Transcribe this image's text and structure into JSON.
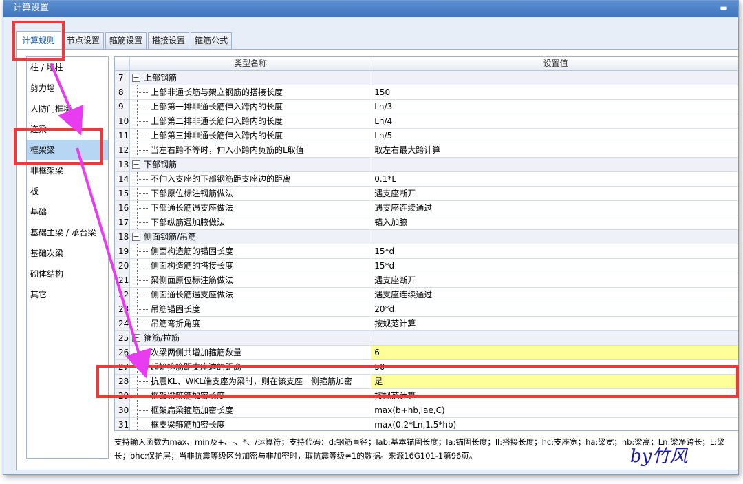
{
  "window": {
    "title": "计算设置",
    "close_glyph": "▬"
  },
  "tabs": [
    {
      "label": "计算规则",
      "active": true
    },
    {
      "label": "节点设置",
      "active": false
    },
    {
      "label": "箍筋设置",
      "active": false
    },
    {
      "label": "搭接设置",
      "active": false
    },
    {
      "label": "箍筋公式",
      "active": false
    }
  ],
  "sidebar": {
    "items": [
      {
        "label": "柱 / 墙柱"
      },
      {
        "label": "剪力墙"
      },
      {
        "label": "人防门框墙"
      },
      {
        "label": "连梁"
      },
      {
        "label": "框架梁",
        "selected": true
      },
      {
        "label": "非框架梁"
      },
      {
        "label": "板"
      },
      {
        "label": "基础"
      },
      {
        "label": "基础主梁 / 承台梁"
      },
      {
        "label": "基础次梁"
      },
      {
        "label": "砌体结构"
      },
      {
        "label": "其它"
      }
    ]
  },
  "grid": {
    "headers": {
      "name": "类型名称",
      "value": "设置值"
    },
    "rows": [
      {
        "num": "7",
        "name": "上部钢筋",
        "value": "",
        "group": true
      },
      {
        "num": "8",
        "name": "上部非通长筋与架立钢筋的搭接长度",
        "value": "150"
      },
      {
        "num": "9",
        "name": "上部第一排非通长筋伸入跨内的长度",
        "value": "Ln/3"
      },
      {
        "num": "10",
        "name": "上部第二排非通长筋伸入跨内的长度",
        "value": "Ln/4"
      },
      {
        "num": "11",
        "name": "上部第三排非通长筋伸入跨内的长度",
        "value": "Ln/5"
      },
      {
        "num": "12",
        "name": "当左右跨不等时，伸入小跨内负筋的L取值",
        "value": "取左右最大跨计算"
      },
      {
        "num": "13",
        "name": "下部钢筋",
        "value": "",
        "group": true
      },
      {
        "num": "14",
        "name": "不伸入支座的下部钢筋距支座边的距离",
        "value": "0.1*L"
      },
      {
        "num": "15",
        "name": "下部原位标注钢筋做法",
        "value": "遇支座断开"
      },
      {
        "num": "16",
        "name": "下部通长筋遇支座做法",
        "value": "遇支座连续通过"
      },
      {
        "num": "17",
        "name": "下部纵筋遇加腋做法",
        "value": "锚入加腋"
      },
      {
        "num": "18",
        "name": "侧面钢筋/吊筋",
        "value": "",
        "group": true
      },
      {
        "num": "19",
        "name": "侧面构造筋的锚固长度",
        "value": "15*d"
      },
      {
        "num": "20",
        "name": "侧面构造筋的搭接长度",
        "value": "15*d"
      },
      {
        "num": "21",
        "name": "梁侧面原位标注筋做法",
        "value": "遇支座断开"
      },
      {
        "num": "22",
        "name": "侧面通长筋遇支座做法",
        "value": "遇支座连续通过"
      },
      {
        "num": "23",
        "name": "吊筋锚固长度",
        "value": "20*d"
      },
      {
        "num": "24",
        "name": "吊筋弯折角度",
        "value": "按规范计算"
      },
      {
        "num": "25",
        "name": "箍筋/拉筋",
        "value": "",
        "group": true
      },
      {
        "num": "26",
        "name": "次梁两侧共增加箍筋数量",
        "value": "6",
        "highlight": true
      },
      {
        "num": "27",
        "name": "起始箍筋距支座边的距离",
        "value": "50"
      },
      {
        "num": "28",
        "name": "抗震KL、WKL端支座为梁时，则在该支座一侧箍筋加密",
        "value": "是",
        "highlight": true
      },
      {
        "num": "29",
        "name": "框架梁箍筋加密长度",
        "value": "按规范计算"
      },
      {
        "num": "30",
        "name": "框架扁梁箍筋加密长度",
        "value": "max(b+hb,lae,C)"
      },
      {
        "num": "31",
        "name": "框支梁箍筋加密长度",
        "value": "max(0.2*Ln,1.5*hb)"
      }
    ]
  },
  "help": {
    "line1": "支持输入函数为max、min及+、-、*、/运算符；支持代码：d:钢筋直径；lab:基本锚固长度；la:锚固长度；ll:搭接长度；hc:支座宽；ha:梁宽；hb:梁高；Ln:梁净跨长；L:梁",
    "line2": "长；bhc:保护层；当非抗震等级区分加密与非加密时，取抗震等级≠1的数据。来源16G101-1第96页。"
  },
  "signature": "by竹风",
  "colors": {
    "annotation_red": "#ec3a3a",
    "arrow_magenta": "#e83cf0",
    "highlight_yellow": "#ffff99",
    "selected_blue": "#b6d6f3"
  }
}
